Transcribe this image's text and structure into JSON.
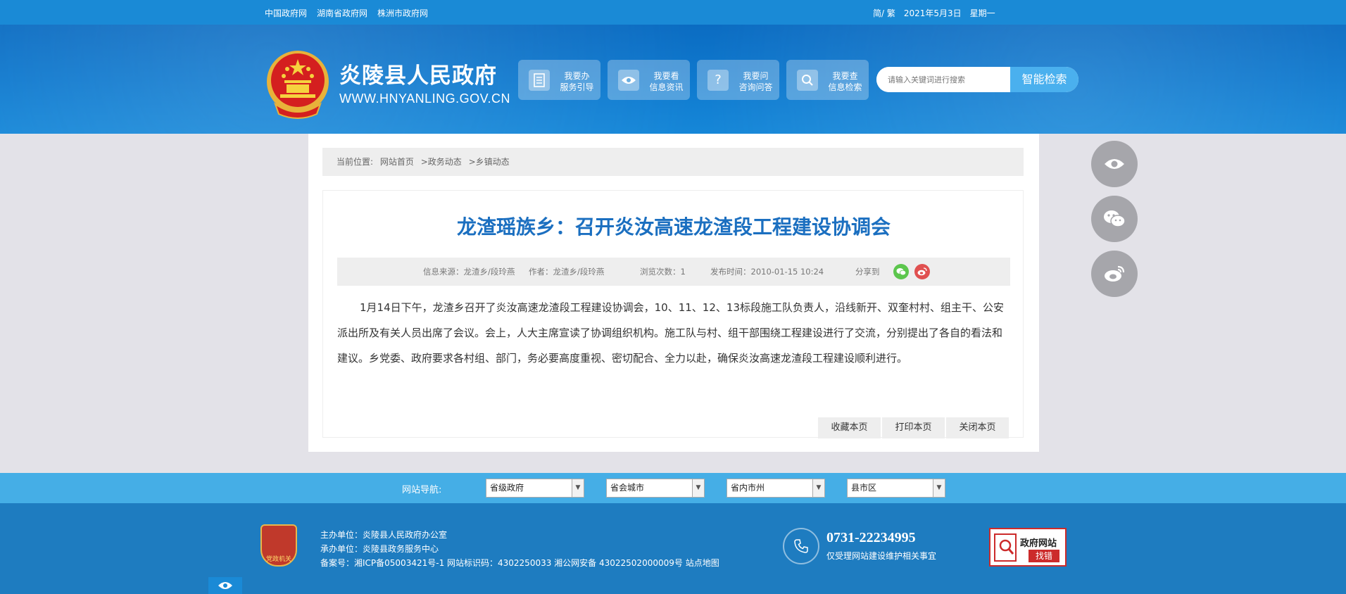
{
  "topbar": {
    "links": [
      "中国政府网",
      "湖南省政府网",
      "株洲市政府网"
    ],
    "lang": "简/ 繁",
    "date": "2021年5月3日",
    "weekday": "星期一"
  },
  "header": {
    "site_name": "炎陵县人民政府",
    "site_url": "WWW.HNYANLING.GOV.CN",
    "quick": [
      {
        "line1": "我要办",
        "line2": "服务引导",
        "icon": "document-icon"
      },
      {
        "line1": "我要看",
        "line2": "信息资讯",
        "icon": "eye-icon"
      },
      {
        "line1": "我要问",
        "line2": "咨询问答",
        "icon": "question-icon"
      },
      {
        "line1": "我要查",
        "line2": "信息检索",
        "icon": "search-icon"
      }
    ],
    "search_placeholder": "请输入关键词进行搜索",
    "search_button": "智能检索"
  },
  "breadcrumb": {
    "prefix": "当前位置:",
    "home": "网站首页",
    "level1": ">政务动态",
    "level2": ">乡镇动态"
  },
  "article": {
    "title": "龙渣瑶族乡：召开炎汝高速龙渣段工程建设协调会",
    "source": "信息来源：龙渣乡/段玲燕",
    "author": "作者：龙渣乡/段玲燕",
    "views": "浏览次数：1",
    "published": "发布时间：2010-01-15 10:24",
    "share_label": "分享到",
    "body": "1月14日下午，龙渣乡召开了炎汝高速龙渣段工程建设协调会，10、11、12、13标段施工队负责人，沿线新开、双奎村村、组主干、公安派出所及有关人员出席了会议。会上，人大主席宣读了协调组织机构。施工队与村、组干部围绕工程建设进行了交流，分别提出了各自的看法和建议。乡党委、政府要求各村组、部门，务必要高度重视、密切配合、全力以赴，确保炎汝高速龙渣段工程建设顺利进行。",
    "actions": [
      "收藏本页",
      "打印本页",
      "关闭本页"
    ]
  },
  "nav": {
    "label": "网站导航:",
    "selects": [
      "省级政府",
      "省会城市",
      "省内市州",
      "县市区"
    ]
  },
  "footer": {
    "host": "主办单位：炎陵县人民政府办公室",
    "organizer": "承办单位：炎陵县政务服务中心",
    "record": "备案号：湘ICP备05003421号-1 网站标识码：4302250033 湘公网安备 43022502000009号 站点地图",
    "badge_text": "党政机关",
    "phone": "0731-22234995",
    "phone_desc": "仅受理网站建设维护相关事宜",
    "error_title": "政府网站",
    "error_tag": "找错"
  },
  "colors": {
    "brand_blue": "#1a8ad6",
    "title_blue": "#1b6fc0",
    "footer_blue": "#1e7cc0",
    "nav_blue": "#45aee6"
  }
}
